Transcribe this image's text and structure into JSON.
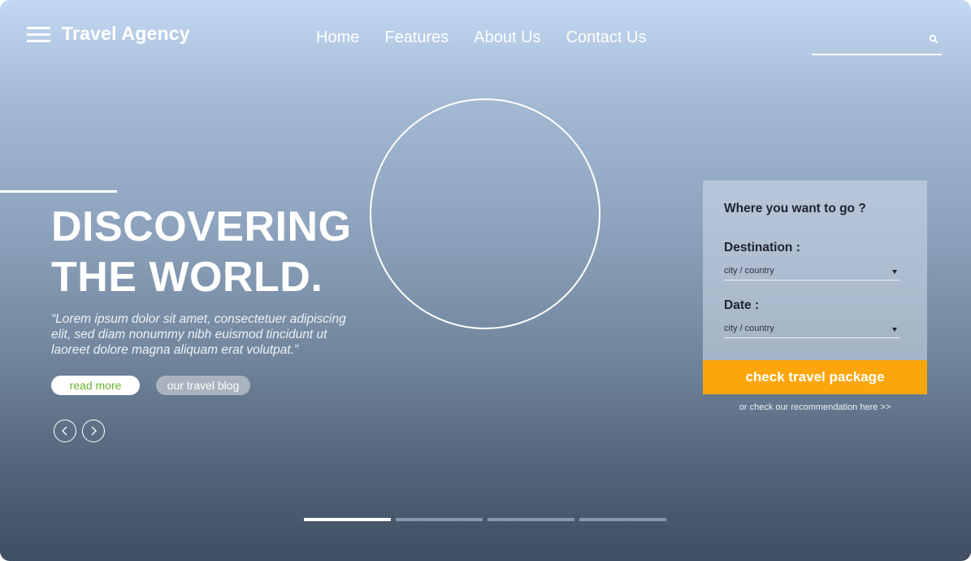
{
  "header": {
    "brand": "Travel Agency",
    "nav": [
      "Home",
      "Features",
      "About Us",
      "Contact Us"
    ],
    "search_placeholder": ""
  },
  "hero": {
    "title_line1": "DISCOVERING",
    "title_line2": "THE WORLD.",
    "quote": "“Lorem ipsum dolor sit amet, consectetuer adipiscing elit, sed diam nonummy nibh euismod tincidunt ut laoreet dolore magna aliquam erat volutpat.”",
    "read_more": "read more",
    "blog": "our travel blog"
  },
  "booking": {
    "title": "Where you want to go ?",
    "destination_label": "Destination :",
    "destination_value": "city / country",
    "date_label": "Date :",
    "date_value": "city / country",
    "cta": "check travel package",
    "recommend": "or check our recommendation here >>"
  },
  "slider": {
    "slides": 4,
    "active_index": 0
  },
  "colors": {
    "accent": "#fca60c",
    "readmore_text": "#6ab22e",
    "bg_top": "#c3d8f2",
    "bg_bottom": "#3f4e60"
  },
  "icons": [
    "menu-icon",
    "search-icon",
    "chevron-left-icon",
    "chevron-right-icon",
    "caret-down-icon"
  ]
}
